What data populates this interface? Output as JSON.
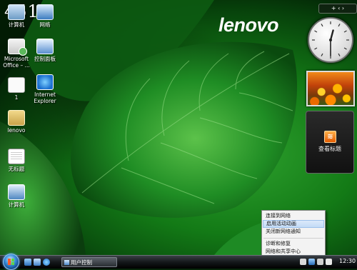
{
  "watermark": "451",
  "brand": "lenovo",
  "desktop_icons": [
    {
      "label": "计算机",
      "icon": "computer-icon"
    },
    {
      "label": "网络",
      "icon": "network-icon"
    },
    {
      "label": "Microsoft Office – ...",
      "icon": "office-icon"
    },
    {
      "label": "控制面板",
      "icon": "control-panel-icon"
    },
    {
      "label": "1",
      "icon": "file-icon"
    },
    {
      "label": "Internet Explorer",
      "icon": "ie-icon"
    },
    {
      "label": "lenovo",
      "icon": "folder-icon"
    },
    {
      "label": "无标题",
      "icon": "document-icon"
    },
    {
      "label": "计算机",
      "icon": "computer-icon"
    }
  ],
  "sidebar": {
    "top_controls": "+ ‹ ›"
  },
  "clock_gadget": {
    "hour": 12,
    "minute": 30
  },
  "feed_gadget": {
    "label": "查看标题",
    "icon": "rss-icon"
  },
  "context_menu": {
    "items": [
      "连接到网络",
      "启用活动动画",
      "关闭新网络通知",
      "诊断和修复",
      "网络和共享中心"
    ],
    "highlighted_index": 1
  },
  "taskbar": {
    "active_window": "用户控制",
    "time": "12:30"
  },
  "colors": {
    "leaf_green": "#2fa32f",
    "taskbar": "#14171a",
    "start_orb": "#3a8fdc"
  }
}
